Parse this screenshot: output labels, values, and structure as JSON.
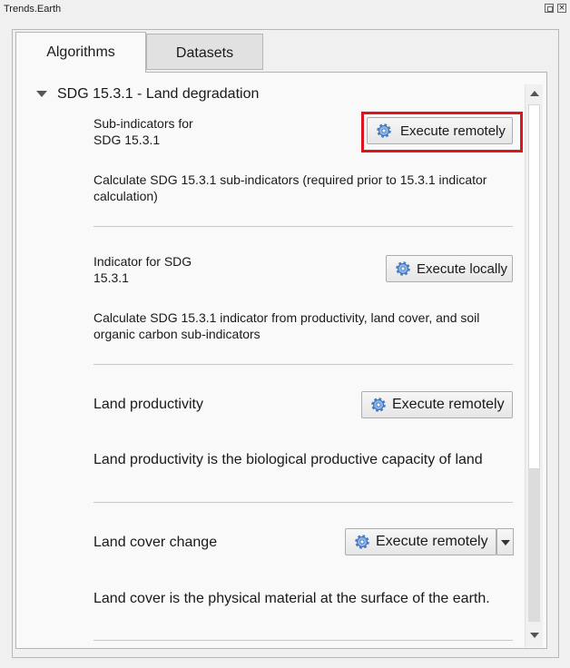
{
  "window": {
    "title": "Trends.Earth"
  },
  "tabs": [
    {
      "label": "Algorithms"
    },
    {
      "label": "Datasets"
    }
  ],
  "group": {
    "title": "SDG 15.3.1 - Land degradation"
  },
  "items": [
    {
      "name_line1": "Sub-indicators for",
      "name_line2": "SDG 15.3.1",
      "button": "Execute remotely",
      "desc_line1": "Calculate SDG 15.3.1 sub-indicators (required prior to 15.3.1 indicator",
      "desc_line2": "calculation)"
    },
    {
      "name_line1": "Indicator for SDG",
      "name_line2": "15.3.1",
      "button": "Execute locally",
      "desc_line1": "Calculate SDG 15.3.1 indicator from productivity, land cover, and soil",
      "desc_line2": "organic carbon sub-indicators"
    },
    {
      "name": "Land productivity",
      "button": "Execute remotely",
      "desc": "Land productivity is the biological productive capacity of land"
    },
    {
      "name": "Land cover change",
      "button": "Execute remotely",
      "desc": "Land cover is the physical material at the surface of the earth."
    }
  ],
  "colors": {
    "highlight": "#e0141e",
    "gear_icon": "#4a7fc4"
  },
  "icons": {
    "execute": "gear-icon",
    "expand": "triangle-down-icon"
  }
}
